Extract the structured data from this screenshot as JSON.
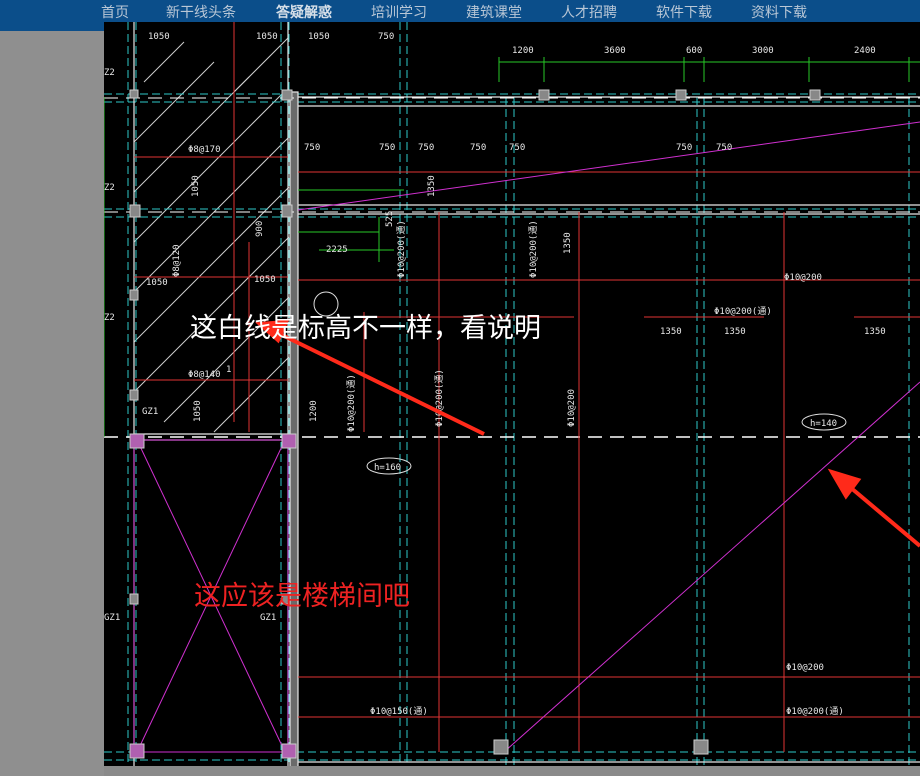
{
  "nav": {
    "items": [
      {
        "label": "首页",
        "active": false
      },
      {
        "label": "新干线头条",
        "active": false
      },
      {
        "label": "答疑解惑",
        "active": true
      },
      {
        "label": "培训学习",
        "active": false
      },
      {
        "label": "建筑课堂",
        "active": false
      },
      {
        "label": "人才招聘",
        "active": false
      },
      {
        "label": "软件下载",
        "active": false
      },
      {
        "label": "资料下载",
        "active": false
      }
    ],
    "bg_color": "#0b4e8a"
  },
  "annotations": {
    "white_note": "这白线是标高不一样，看说明",
    "red_note": "这应该是楼梯间吧",
    "arrow_color": "#ff2a1a"
  },
  "drawing": {
    "dims_top": [
      "1200",
      "3600",
      "600",
      "3000",
      "2400"
    ],
    "dims_left_top": [
      "1050",
      "1050",
      "1050",
      "750"
    ],
    "dims_row": [
      "750",
      "750",
      "750",
      "750",
      "750",
      "750",
      "750"
    ],
    "dims_row2": [
      "1350",
      "1350",
      "1350"
    ],
    "column_tags": [
      "Z2",
      "Z2",
      "Z2",
      "GZ1",
      "GZ1",
      "GZ1"
    ],
    "rebar_labels": [
      "Φ8@170",
      "Φ8@120",
      "Φ8@140",
      "Φ10@200",
      "Φ10@200(通)",
      "Φ10@200(通)",
      "Φ10@200(通)",
      "Φ10@200(通)",
      "Φ10@200(通)",
      "Φ10@200",
      "Φ10@200(通)",
      "Φ10@150(通)"
    ],
    "small_dims": [
      "1050",
      "1050",
      "1050",
      "1350",
      "1350",
      "900",
      "525",
      "2225",
      "1200",
      "1050"
    ],
    "heights": [
      "h=160",
      "h=140"
    ],
    "axis_mark": "1"
  }
}
